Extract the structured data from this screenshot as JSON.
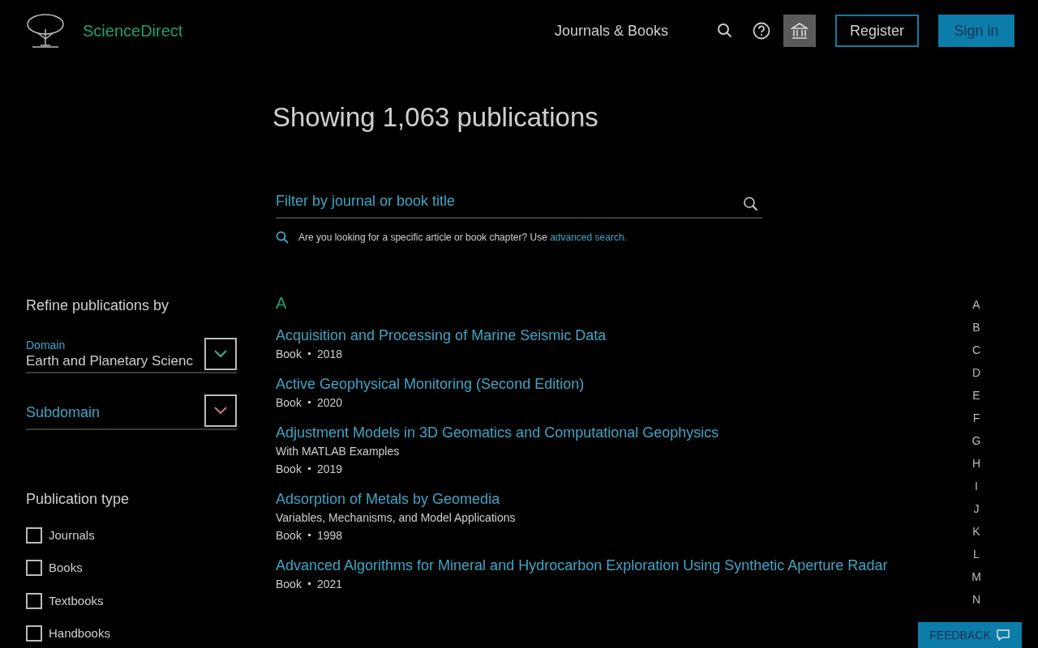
{
  "header": {
    "brand": "ScienceDirect",
    "nav_link": "Journals & Books",
    "register": "Register",
    "sign_in": "Sign in"
  },
  "heading": "Showing 1,063 publications",
  "filter": {
    "placeholder": "Filter by journal or book title",
    "hint": "Are you looking for a specific article or book chapter? Use",
    "hint_link": "advanced search."
  },
  "sidebar": {
    "title": "Refine publications by",
    "dropdowns": [
      {
        "label": "Domain",
        "value": "Earth and Planetary Scienc"
      },
      {
        "placeholder": "Subdomain"
      }
    ],
    "type_title": "Publication type",
    "types": [
      {
        "label": "Journals",
        "checked": false
      },
      {
        "label": "Books",
        "checked": false
      },
      {
        "label": "Textbooks",
        "checked": false
      },
      {
        "label": "Handbooks",
        "checked": false
      }
    ]
  },
  "section_letter": "A",
  "publications": [
    {
      "title": "Acquisition and Processing of Marine Seismic Data",
      "type": "Book",
      "year": "2018"
    },
    {
      "title": "Active Geophysical Monitoring (Second Edition)",
      "type": "Book",
      "year": "2020"
    },
    {
      "title": "Adjustment Models in 3D Geomatics and Computational Geophysics",
      "subtitle": "With MATLAB Examples",
      "type": "Book",
      "year": "2019"
    },
    {
      "title": "Adsorption of Metals by Geomedia",
      "subtitle": "Variables, Mechanisms, and Model Applications",
      "type": "Book",
      "year": "1998"
    },
    {
      "title": "Advanced Algorithms for Mineral and Hydrocarbon Exploration Using Synthetic Aperture Radar",
      "type": "Book",
      "year": "2021"
    }
  ],
  "alphabet": [
    "A",
    "B",
    "C",
    "D",
    "E",
    "F",
    "G",
    "H",
    "I",
    "J",
    "K",
    "L",
    "M",
    "N"
  ],
  "feedback": "FEEDBACK"
}
